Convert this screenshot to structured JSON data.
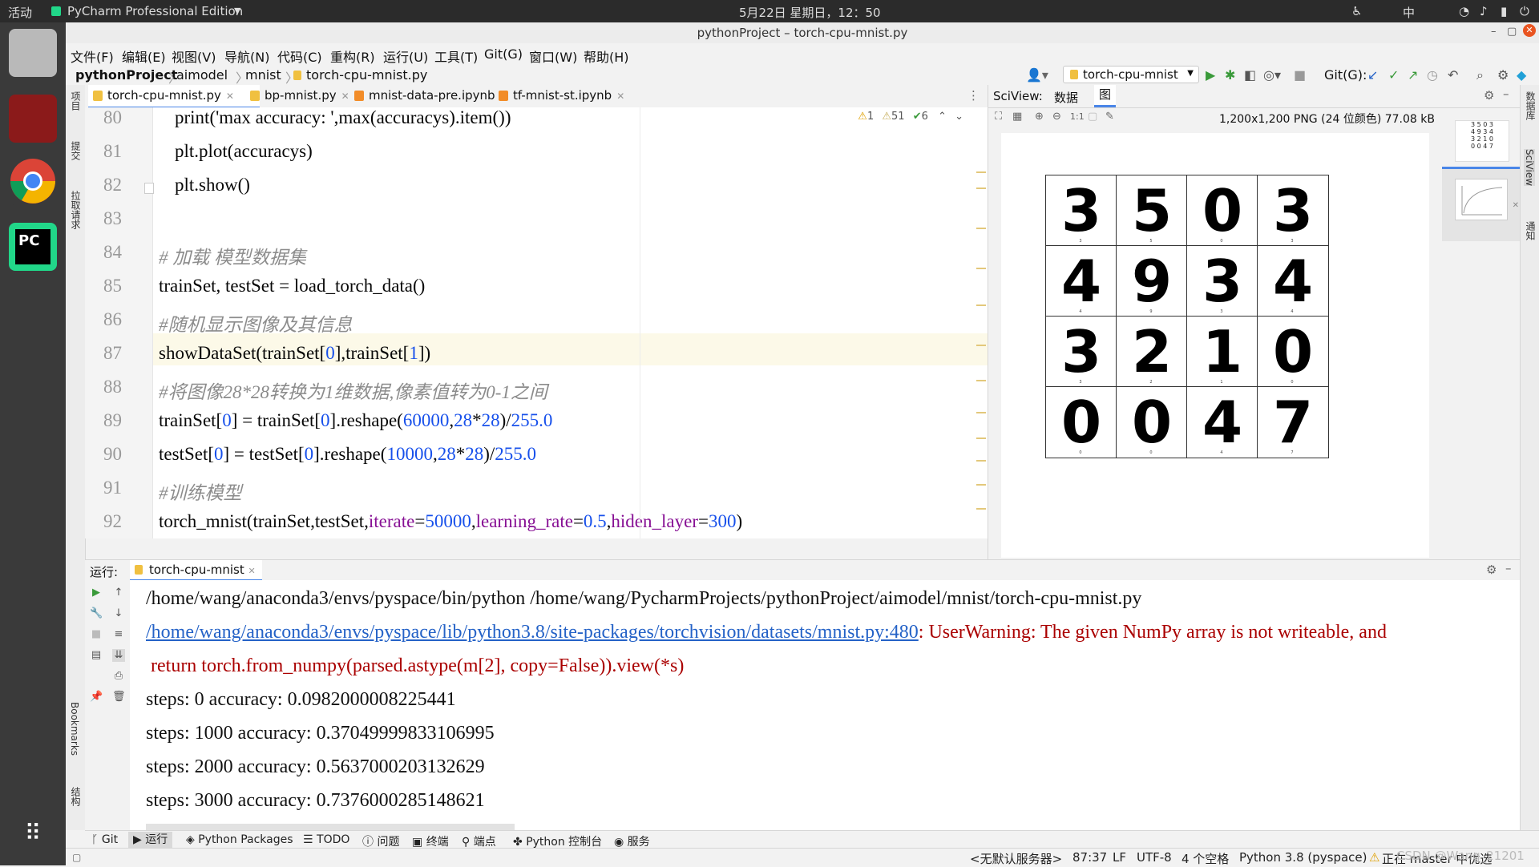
{
  "system": {
    "activities": "活动",
    "app_menu": "PyCharm Professional Edition",
    "clock": "5月22日 星期日，12：50",
    "input_method": "中"
  },
  "window": {
    "title": "pythonProject – torch-cpu-mnist.py"
  },
  "menu": [
    "文件(F)",
    "编辑(E)",
    "视图(V)",
    "导航(N)",
    "代码(C)",
    "重构(R)",
    "运行(U)",
    "工具(T)",
    "Git(G)",
    "窗口(W)",
    "帮助(H)"
  ],
  "breadcrumb": [
    "pythonProject",
    "aimodel",
    "mnist",
    "torch-cpu-mnist.py"
  ],
  "run_config": "torch-cpu-mnist",
  "git_label": "Git(G):",
  "left_strip": [
    "项目",
    "提交",
    "拉取请求",
    "Bookmarks",
    "结构"
  ],
  "right_strip": [
    "数据库",
    "SciView",
    "通知"
  ],
  "tabs": [
    "torch-cpu-mnist.py",
    "bp-mnist.py",
    "mnist-data-pre.ipynb",
    "tf-mnist-st.ipynb"
  ],
  "inspections": {
    "warn1": "1",
    "warn2": "51",
    "ok": "6"
  },
  "code": {
    "line_numbers": [
      "80",
      "81",
      "82",
      "83",
      "84",
      "85",
      "86",
      "87",
      "88",
      "89",
      "90",
      "91",
      "92"
    ],
    "l80": "print('max accuracy: ',max(accuracys).item())",
    "l81": "plt.plot(accuracys)",
    "l82": "plt.show()",
    "l84": "# 加载 模型数据集",
    "l85": "trainSet, testSet = load_torch_data()",
    "l86": "#随机显示图像及其信息",
    "l87a": "showDataSet(trainSet[",
    "l87b": "0",
    "l87c": "],trainSet[",
    "l87d": "1",
    "l87e": "])",
    "l88": "#将图像28*28转换为1维数据,像素值转为0-1之间",
    "l89a": "trainSet[",
    "l89b": "0",
    "l89c": "] = trainSet[",
    "l89d": "0",
    "l89e": "].reshape(",
    "l89f": "60000",
    "l89g": ",",
    "l89h": "28",
    "l89i": "*",
    "l89j": "28",
    "l89k": ")/",
    "l89l": "255.0",
    "l90a": "testSet[",
    "l90b": "0",
    "l90c": "] = testSet[",
    "l90d": "0",
    "l90e": "].reshape(",
    "l90f": "10000",
    "l90g": ",",
    "l90h": "28",
    "l90i": "*",
    "l90j": "28",
    "l90k": ")/",
    "l90l": "255.0",
    "l91": "#训练模型",
    "l92a": "torch_mnist(trainSet,testSet,",
    "l92b": "iterate",
    "l92c": "=",
    "l92d": "50000",
    "l92e": ",",
    "l92f": "learning_rate",
    "l92g": "=",
    "l92h": "0.5",
    "l92i": ",",
    "l92j": "hiden_layer",
    "l92k": "=",
    "l92l": "300",
    "l92m": ")"
  },
  "sciview": {
    "label": "SciView:",
    "tab_data": "数据",
    "tab_plot": "图",
    "image_info": "1,200x1,200 PNG (24 位颜色) 77.08 kB",
    "zoom_label": "1:1",
    "digits": [
      "3",
      "5",
      "0",
      "3",
      "4",
      "9",
      "3",
      "4",
      "3",
      "2",
      "1",
      "0",
      "0",
      "0",
      "4",
      "7"
    ]
  },
  "run": {
    "label": "运行:",
    "tab": "torch-cpu-mnist",
    "cmd": "/home/wang/anaconda3/envs/pyspace/bin/python /home/wang/PycharmProjects/pythonProject/aimodel/mnist/torch-cpu-mnist.py",
    "warn_link": "/home/wang/anaconda3/envs/pyspace/lib/python3.8/site-packages/torchvision/datasets/mnist.py:480",
    "warn_text": ": UserWarning: The given NumPy array is not writeable, and",
    "warn_line2": " return torch.from_numpy(parsed.astype(m[2], copy=False)).view(*s)",
    "steps": [
      "steps: 0 accuracy: 0.0982000008225441",
      "steps: 1000 accuracy: 0.37049999833106995",
      "steps: 2000 accuracy: 0.5637000203132629",
      "steps: 3000 accuracy: 0.7376000285148621"
    ]
  },
  "tool_tabs": [
    "Git",
    "运行",
    "Python Packages",
    "TODO",
    "问题",
    "终端",
    "端点",
    "Python 控制台",
    "服务"
  ],
  "status": {
    "server": "<无默认服务器>",
    "position": "87:37",
    "line_sep": "LF",
    "encoding": "UTF-8",
    "indent": "4 个空格",
    "interpreter": "Python 3.8 (pyspace)",
    "branch": "正在 master 中优选",
    "watermark": "CSDN @Wang_21201"
  },
  "colors": {
    "accent": "#4a86e8",
    "pycharm_green": "#21d789",
    "warn_red": "#a00000"
  }
}
